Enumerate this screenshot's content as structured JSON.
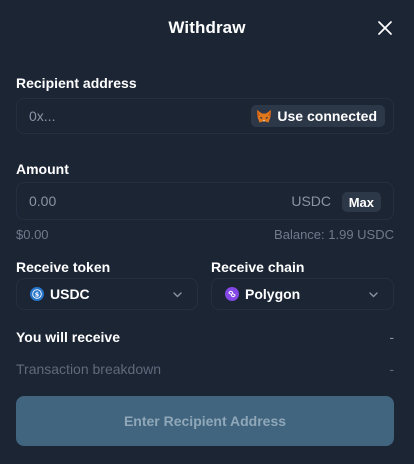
{
  "dialog": {
    "title": "Withdraw"
  },
  "recipient": {
    "label": "Recipient address",
    "placeholder": "0x...",
    "use_connected_label": "Use connected"
  },
  "amount": {
    "label": "Amount",
    "placeholder": "0.00",
    "unit": "USDC",
    "max_label": "Max",
    "fiat_value": "$0.00",
    "balance": "Balance: 1.99 USDC"
  },
  "receive_token": {
    "label": "Receive token",
    "selected": "USDC",
    "icon": "usdc-icon"
  },
  "receive_chain": {
    "label": "Receive chain",
    "selected": "Polygon",
    "icon": "polygon-icon"
  },
  "summary": {
    "you_will_receive_label": "You will receive",
    "you_will_receive_value": "-",
    "breakdown_label": "Transaction breakdown",
    "breakdown_value": "-"
  },
  "cta": {
    "label": "Enter Recipient Address"
  },
  "colors": {
    "background": "#1b2534",
    "border": "#243042",
    "muted_text": "#8a94a6",
    "button_bg": "#2c3748",
    "cta_bg": "#41657e",
    "cta_text": "#8fa7b8",
    "usdc": "#2775ca",
    "polygon": "#8247e5"
  }
}
